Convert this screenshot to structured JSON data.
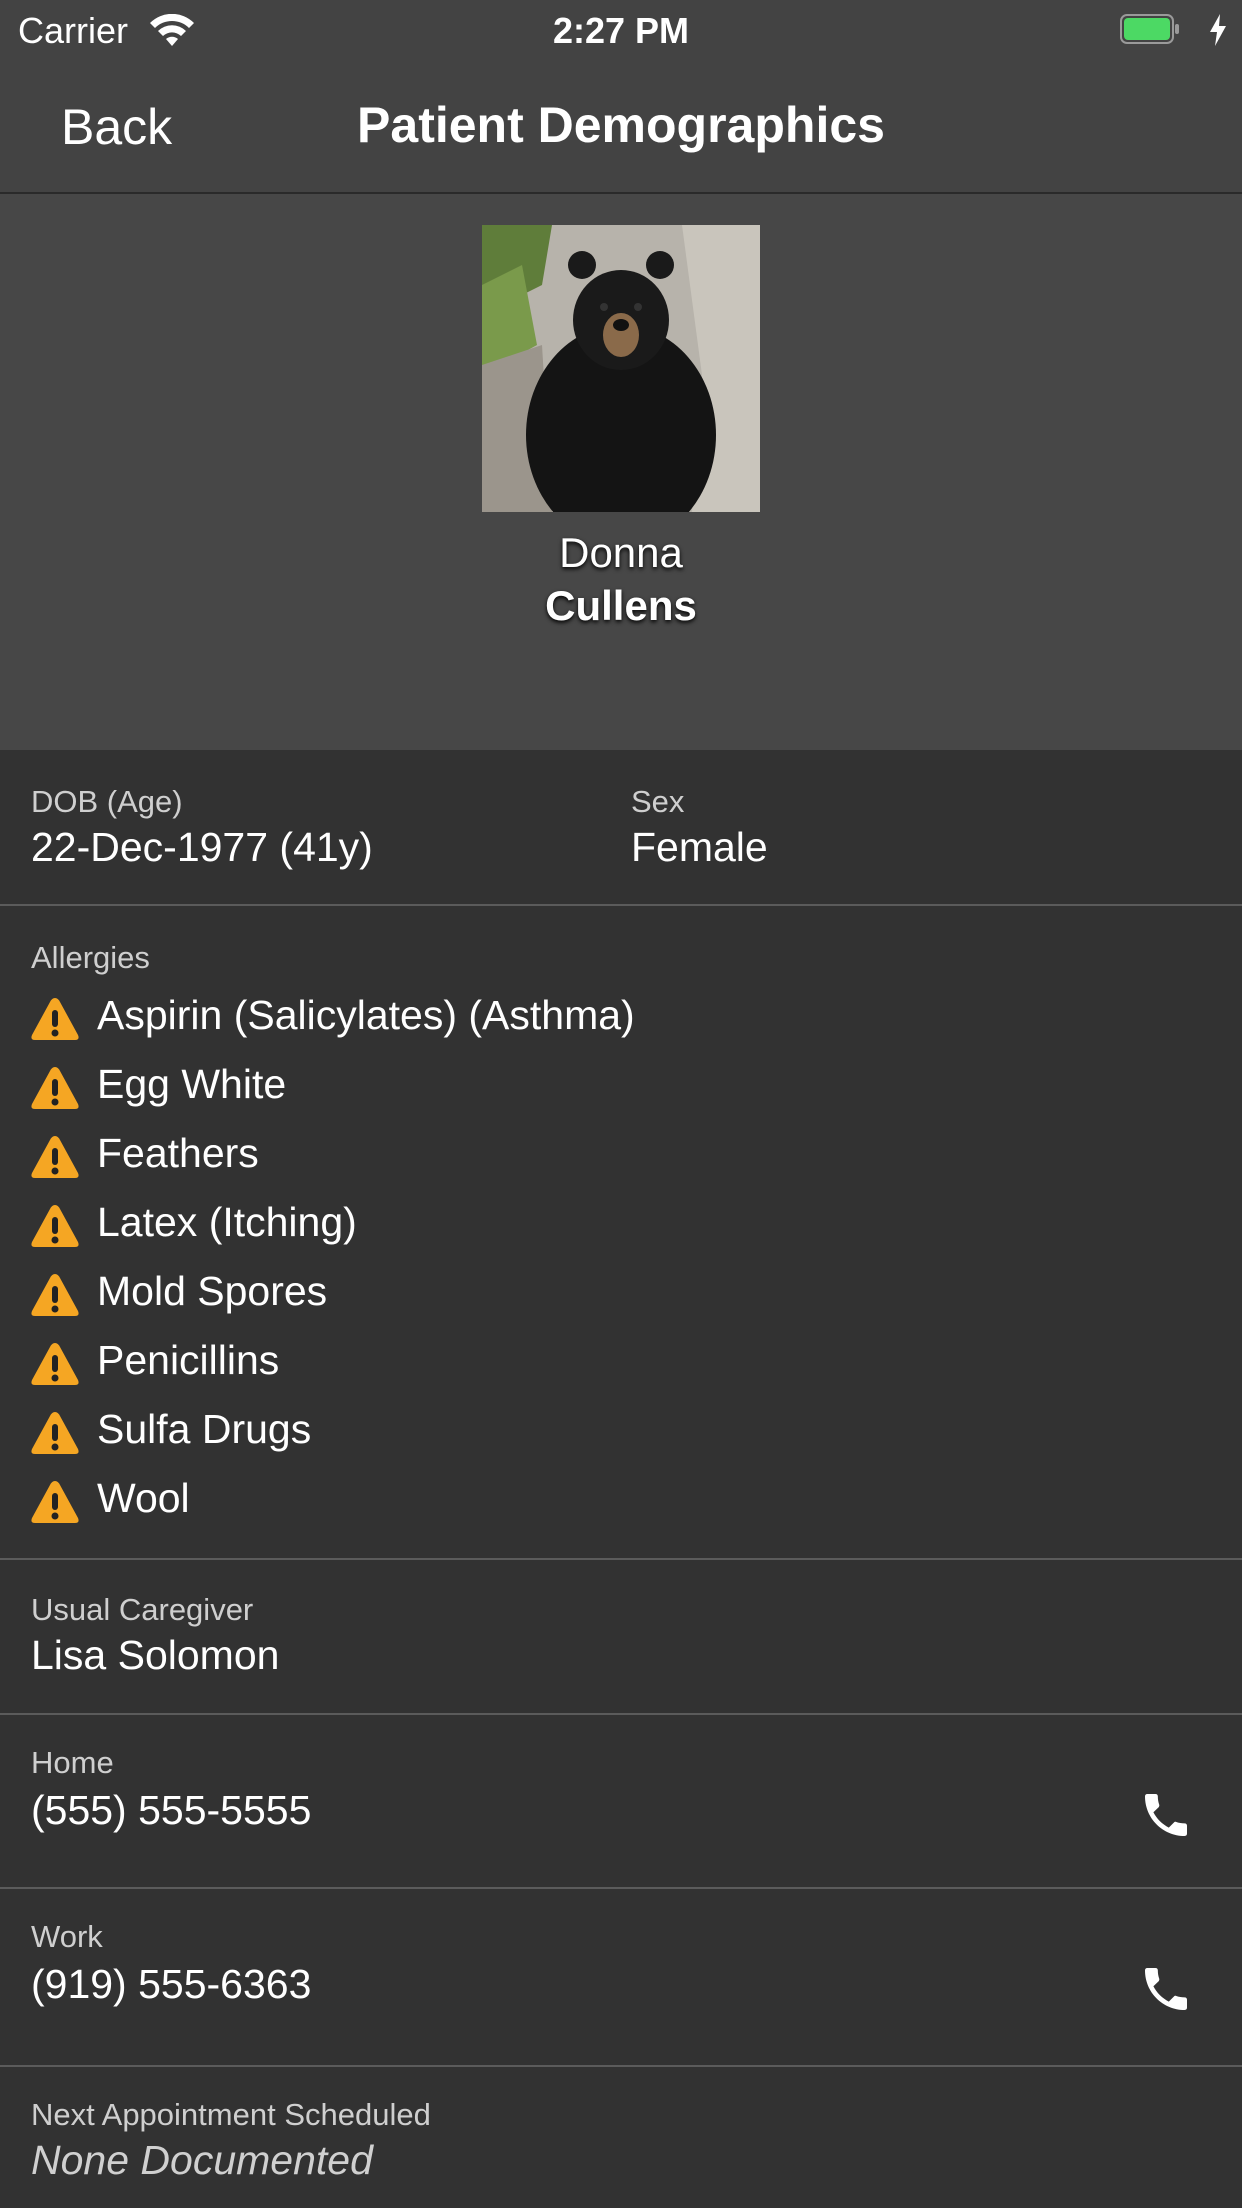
{
  "status_bar": {
    "carrier": "Carrier",
    "time": "2:27 PM"
  },
  "nav": {
    "back_label": "Back",
    "title": "Patient Demographics"
  },
  "patient": {
    "first_name": "Donna",
    "last_name": "Cullens"
  },
  "demographics": {
    "dob_label": "DOB (Age)",
    "dob_value": "22-Dec-1977 (41y)",
    "sex_label": "Sex",
    "sex_value": "Female"
  },
  "allergies": {
    "label": "Allergies",
    "items": [
      "Aspirin (Salicylates) (Asthma)",
      "Egg White",
      "Feathers",
      "Latex (Itching)",
      "Mold Spores",
      "Penicillins",
      "Sulfa Drugs",
      "Wool"
    ]
  },
  "caregiver": {
    "label": "Usual Caregiver",
    "value": "Lisa  Solomon"
  },
  "phones": [
    {
      "label": "Home",
      "value": "(555) 555-5555"
    },
    {
      "label": "Work",
      "value": "(919) 555-6363"
    }
  ],
  "appointment": {
    "label": "Next Appointment Scheduled",
    "value": "None Documented"
  },
  "colors": {
    "warning": "#f5a623",
    "battery": "#4cd964"
  }
}
